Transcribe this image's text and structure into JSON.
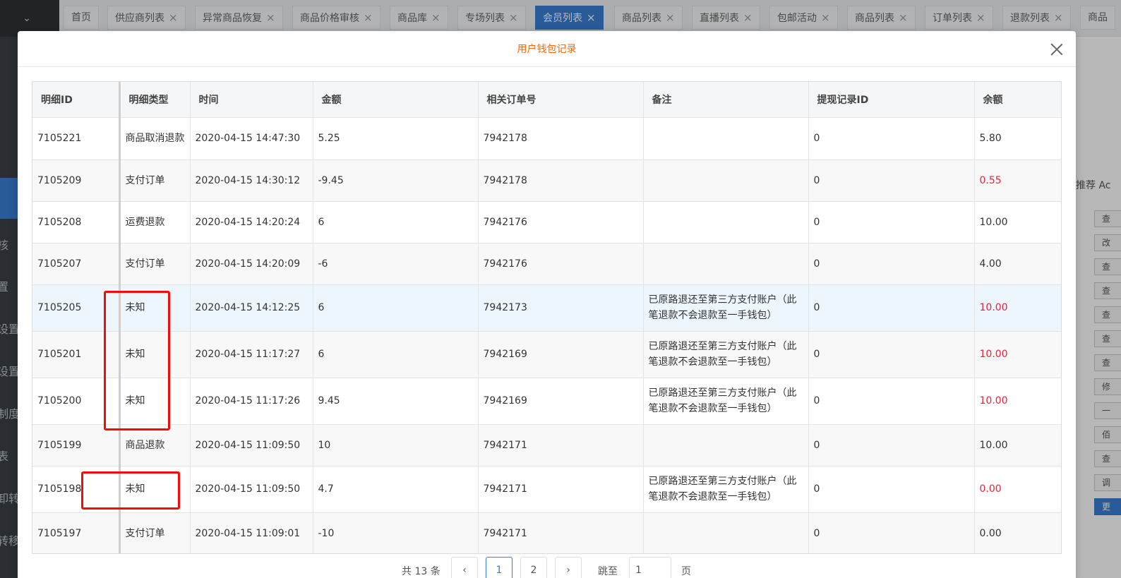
{
  "sidebar": {
    "chevron": "⌄",
    "fragments": [
      "核",
      "置",
      "设置",
      "设置",
      "制度设",
      "表",
      "卸转",
      "转移"
    ]
  },
  "tabs": [
    {
      "label": "首页",
      "closable": false,
      "active": false
    },
    {
      "label": "供应商列表",
      "closable": true,
      "active": false
    },
    {
      "label": "异常商品恢复",
      "closable": true,
      "active": false
    },
    {
      "label": "商品价格审核",
      "closable": true,
      "active": false
    },
    {
      "label": "商品库",
      "closable": true,
      "active": false
    },
    {
      "label": "专场列表",
      "closable": true,
      "active": false
    },
    {
      "label": "会员列表",
      "closable": true,
      "active": true
    },
    {
      "label": "商品列表",
      "closable": true,
      "active": false
    },
    {
      "label": "直播列表",
      "closable": true,
      "active": false
    },
    {
      "label": "包邮活动",
      "closable": true,
      "active": false
    },
    {
      "label": "商品列表",
      "closable": true,
      "active": false
    },
    {
      "label": "订单列表",
      "closable": true,
      "active": false
    },
    {
      "label": "退款列表",
      "closable": true,
      "active": false
    },
    {
      "label": "商品",
      "closable": false,
      "active": false
    }
  ],
  "background": {
    "right_header": "推荐 Ac",
    "right_buttons": [
      "查",
      "改",
      "查",
      "查",
      "查",
      "查",
      "查",
      "修",
      "一",
      "佰",
      "查",
      "调",
      "更"
    ]
  },
  "modal": {
    "title": "用户钱包记录",
    "close_icon": "close-icon"
  },
  "table": {
    "headers": [
      "明细ID",
      "明细类型",
      "时间",
      "金额",
      "相关订单号",
      "备注",
      "提现记录ID",
      "余额"
    ],
    "rows": [
      {
        "id": "7105221",
        "type": "商品取消退款",
        "time": "2020-04-15 14:47:30",
        "amount": "5.25",
        "order": "7942178",
        "remark": "",
        "withdraw_id": "0",
        "balance": "5.80",
        "balance_red": false
      },
      {
        "id": "7105209",
        "type": "支付订单",
        "time": "2020-04-15 14:30:12",
        "amount": "-9.45",
        "order": "7942178",
        "remark": "",
        "withdraw_id": "0",
        "balance": "0.55",
        "balance_red": true
      },
      {
        "id": "7105208",
        "type": "运费退款",
        "time": "2020-04-15 14:20:24",
        "amount": "6",
        "order": "7942176",
        "remark": "",
        "withdraw_id": "0",
        "balance": "10.00",
        "balance_red": false
      },
      {
        "id": "7105207",
        "type": "支付订单",
        "time": "2020-04-15 14:20:09",
        "amount": "-6",
        "order": "7942176",
        "remark": "",
        "withdraw_id": "0",
        "balance": "4.00",
        "balance_red": false
      },
      {
        "id": "7105205",
        "type": "未知",
        "time": "2020-04-15 14:12:25",
        "amount": "6",
        "order": "7942173",
        "remark": "已原路退还至第三方支付账户（此笔退款不会退款至一手钱包）",
        "withdraw_id": "0",
        "balance": "10.00",
        "balance_red": true
      },
      {
        "id": "7105201",
        "type": "未知",
        "time": "2020-04-15 11:17:27",
        "amount": "6",
        "order": "7942169",
        "remark": "已原路退还至第三方支付账户（此笔退款不会退款至一手钱包）",
        "withdraw_id": "0",
        "balance": "10.00",
        "balance_red": true
      },
      {
        "id": "7105200",
        "type": "未知",
        "time": "2020-04-15 11:17:26",
        "amount": "9.45",
        "order": "7942169",
        "remark": "已原路退还至第三方支付账户（此笔退款不会退款至一手钱包）",
        "withdraw_id": "0",
        "balance": "10.00",
        "balance_red": true
      },
      {
        "id": "7105199",
        "type": "商品退款",
        "time": "2020-04-15 11:09:50",
        "amount": "10",
        "order": "7942171",
        "remark": "",
        "withdraw_id": "0",
        "balance": "10.00",
        "balance_red": false
      },
      {
        "id": "7105198",
        "type": "未知",
        "time": "2020-04-15 11:09:50",
        "amount": "4.7",
        "order": "7942171",
        "remark": "已原路退还至第三方支付账户（此笔退款不会退款至一手钱包）",
        "withdraw_id": "0",
        "balance": "0.00",
        "balance_red": true
      },
      {
        "id": "7105197",
        "type": "支付订单",
        "time": "2020-04-15 11:09:01",
        "amount": "-10",
        "order": "7942171",
        "remark": "",
        "withdraw_id": "0",
        "balance": "0.00",
        "balance_red": false
      }
    ]
  },
  "pagination": {
    "total_text": "共 13 条",
    "prev_icon": "‹",
    "pages": [
      "1",
      "2"
    ],
    "current_page": "1",
    "next_icon": "›",
    "goto_label": "跳至",
    "goto_value": "1",
    "page_suffix": "页"
  },
  "colors": {
    "accent": "#3a7fd5",
    "title": "#ff6600",
    "negative_balance": "#e6243b",
    "annotation": "#f20d0d"
  }
}
